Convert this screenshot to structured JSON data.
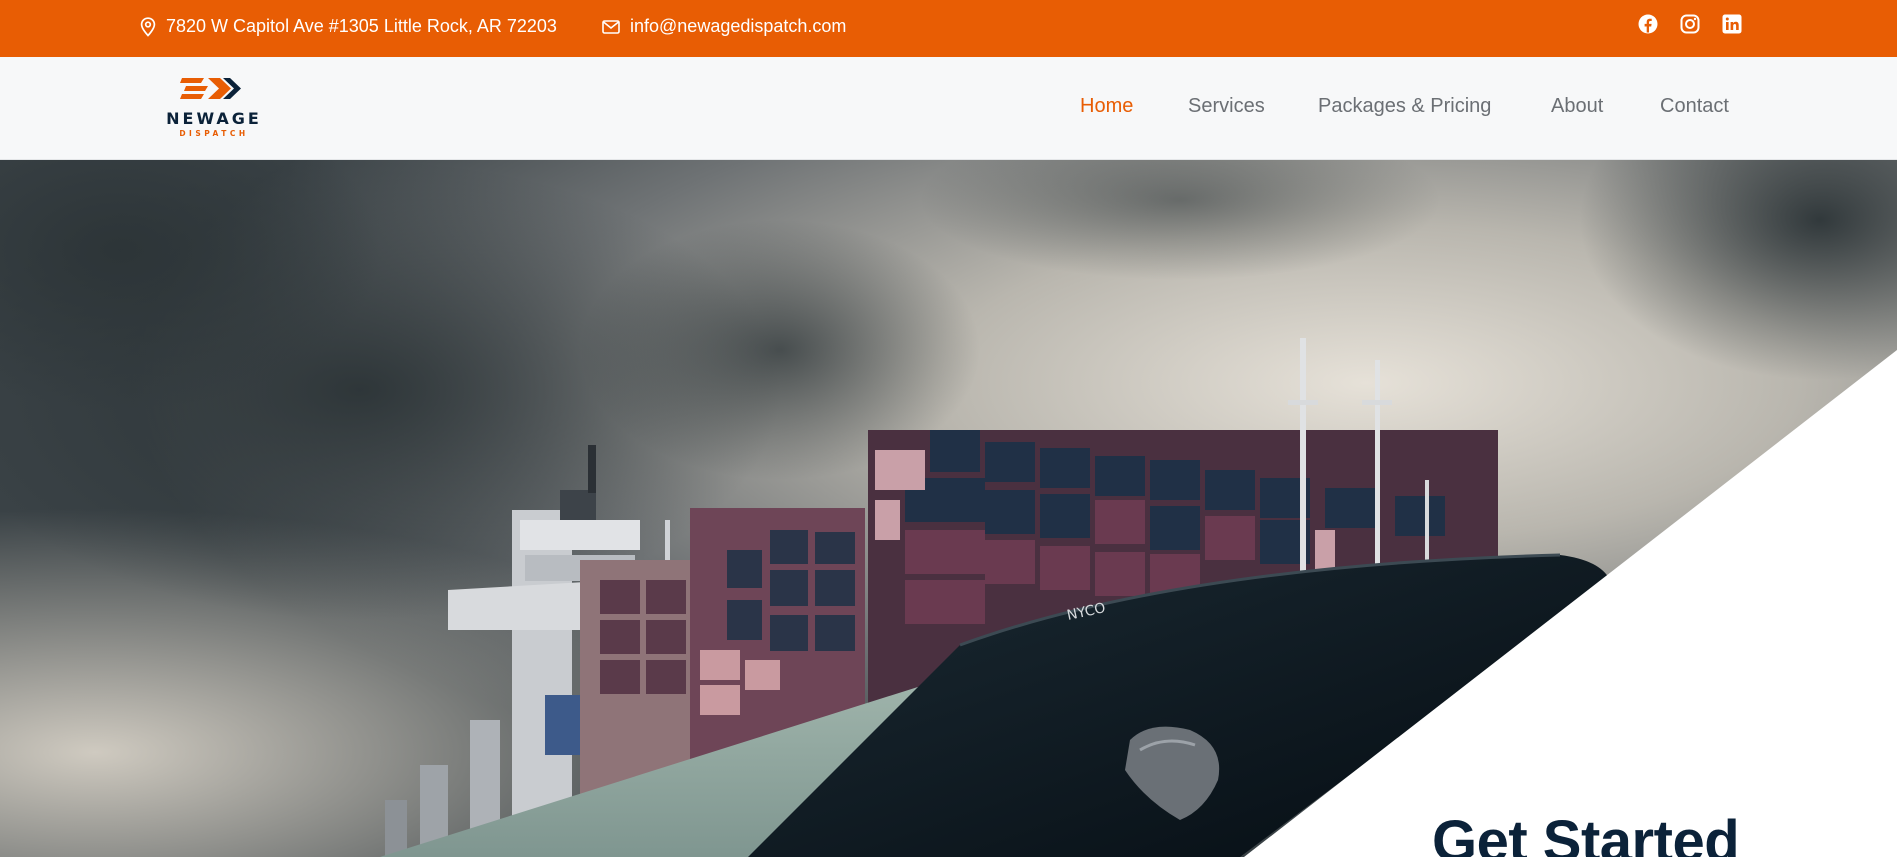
{
  "topbar": {
    "address": "7820 W Capitol Ave #1305 Little Rock, AR 72203",
    "email": "info@newagedispatch.com",
    "icons": [
      "map-pin-icon",
      "envelope-icon",
      "facebook-icon",
      "instagram-icon",
      "linkedin-icon"
    ]
  },
  "brand": {
    "name": "NEWAGE",
    "tagline": "DISPATCH"
  },
  "nav": {
    "items": [
      {
        "label": "Home",
        "active": true
      },
      {
        "label": "Services",
        "active": false
      },
      {
        "label": "Packages & Pricing",
        "active": false
      },
      {
        "label": "About",
        "active": false
      },
      {
        "label": "Contact",
        "active": false
      }
    ]
  },
  "hero": {
    "cta_title": "Get Started"
  },
  "colors": {
    "accent": "#e85d04",
    "navy": "#0b2239",
    "nav_text": "#6b6f74",
    "header_bg": "#f7f8f9"
  }
}
